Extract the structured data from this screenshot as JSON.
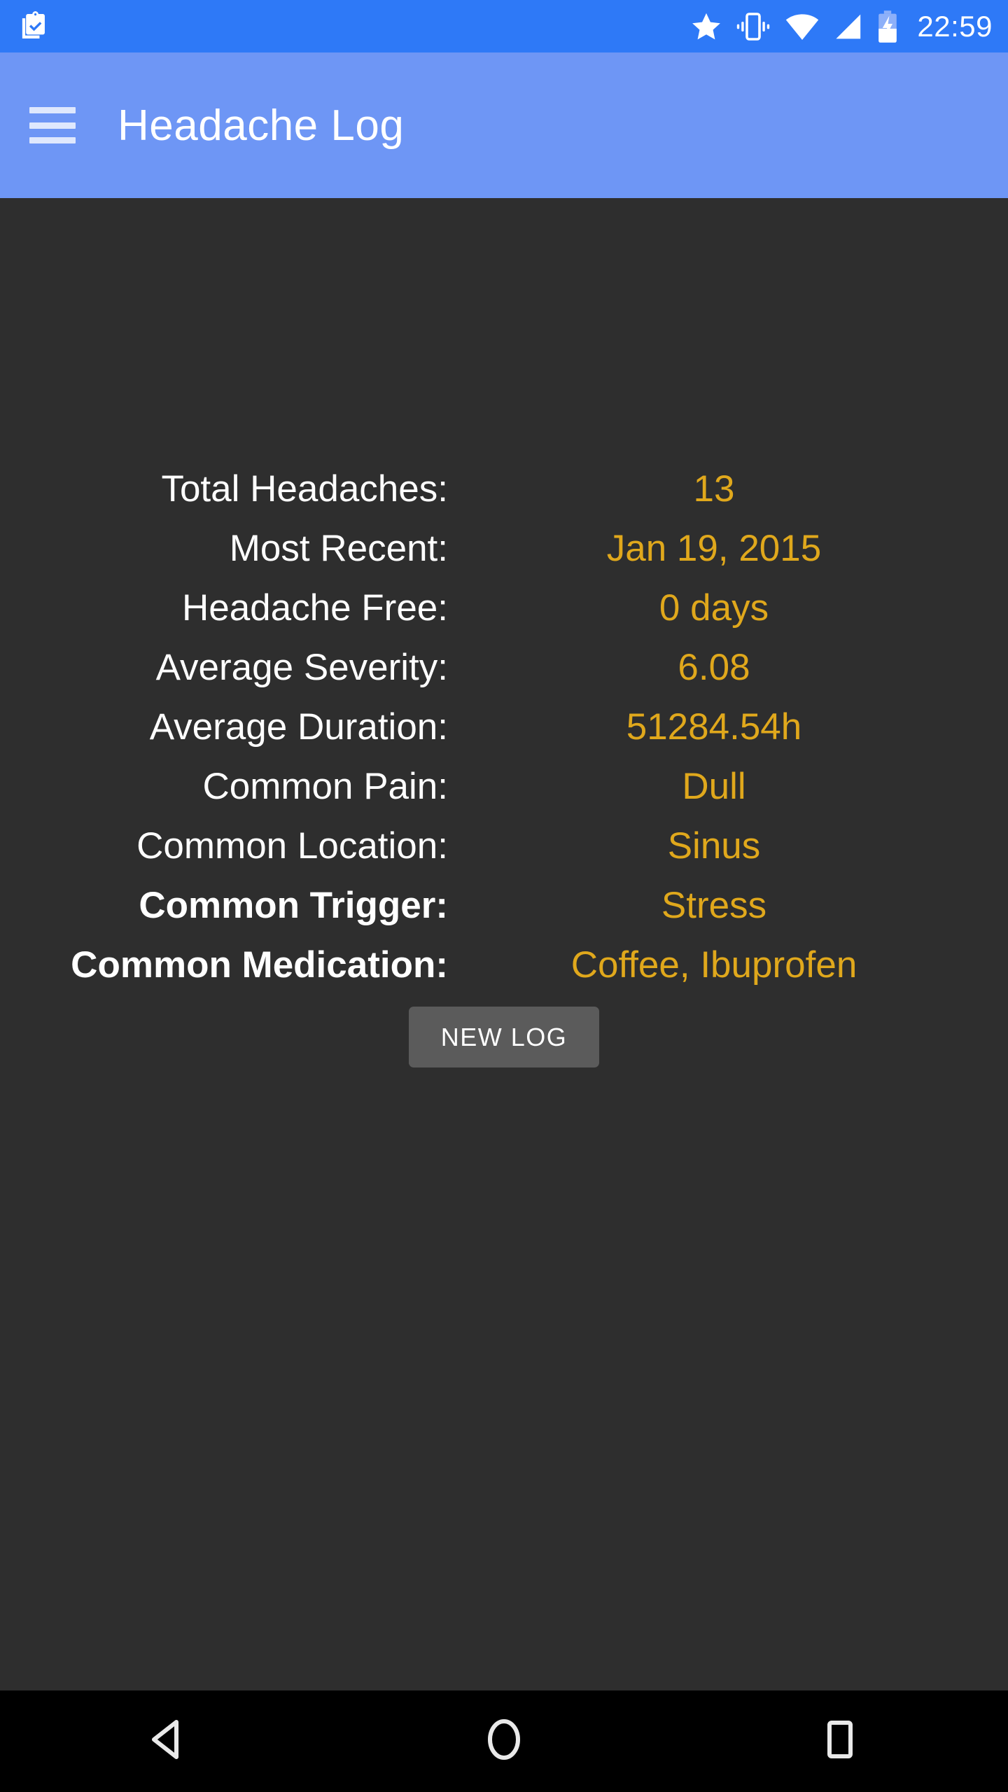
{
  "status_bar": {
    "notification_icon": "clipboard-check-icon",
    "icons": [
      "star-icon",
      "vibrate-icon",
      "wifi-icon",
      "cellular-signal-icon",
      "battery-charging-icon"
    ],
    "time": "22:59",
    "background_color": "#2e79f7"
  },
  "app_bar": {
    "menu_icon": "hamburger-menu-icon",
    "title": "Headache Log",
    "background_color": "#6e96f5"
  },
  "screen": {
    "background_color": "#2e2e2e",
    "value_color": "#e0a81c",
    "label_color": "#ffffff"
  },
  "stats": [
    {
      "label": "Total Headaches:",
      "value": "13",
      "bold": false
    },
    {
      "label": "Most Recent:",
      "value": "Jan 19, 2015",
      "bold": false
    },
    {
      "label": "Headache Free:",
      "value": "0 days",
      "bold": false
    },
    {
      "label": "Average Severity:",
      "value": "6.08",
      "bold": false
    },
    {
      "label": "Average Duration:",
      "value": "51284.54h",
      "bold": false
    },
    {
      "label": "Common Pain:",
      "value": "Dull",
      "bold": false
    },
    {
      "label": "Common Location:",
      "value": "Sinus",
      "bold": false
    },
    {
      "label": "Common Trigger:",
      "value": "Stress",
      "bold": true
    },
    {
      "label": "Common Medication:",
      "value": "Coffee, Ibuprofen",
      "bold": true
    }
  ],
  "actions": {
    "new_log_label": "NEW LOG"
  },
  "nav_bar": {
    "back_icon": "back-triangle-icon",
    "home_icon": "home-circle-icon",
    "recents_icon": "recents-square-icon",
    "background_color": "#000000"
  }
}
